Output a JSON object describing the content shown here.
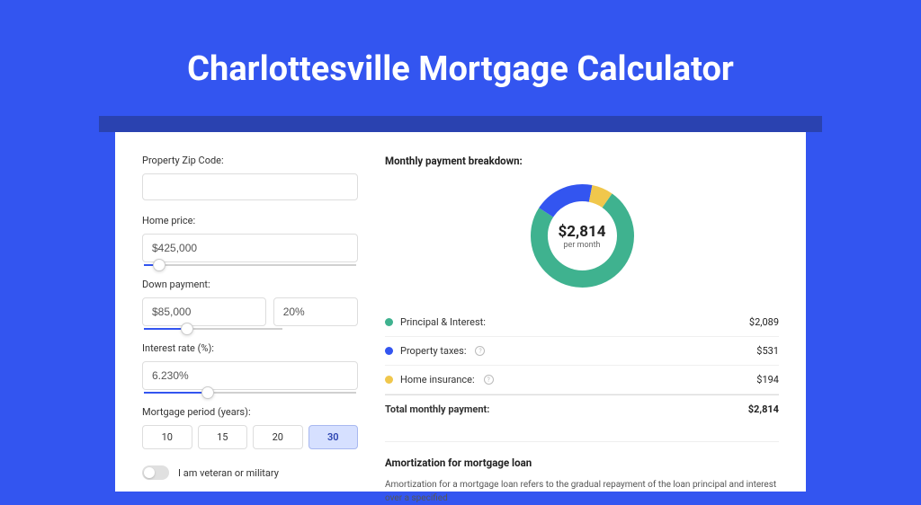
{
  "header": {
    "title": "Charlottesville Mortgage Calculator"
  },
  "form": {
    "zip_label": "Property Zip Code:",
    "zip_value": "",
    "price_label": "Home price:",
    "price_value": "$425,000",
    "price_slider_pct": 7,
    "down_label": "Down payment:",
    "down_value": "$85,000",
    "down_pct_value": "20%",
    "down_slider_pct": 20,
    "rate_label": "Interest rate (%):",
    "rate_value": "6.230%",
    "rate_slider_pct": 30,
    "period_label": "Mortgage period (years):",
    "periods": [
      "10",
      "15",
      "20",
      "30"
    ],
    "period_active": "30",
    "toggle_label": "I am veteran or military"
  },
  "breakdown": {
    "title": "Monthly payment breakdown:",
    "total_amount": "$2,814",
    "total_sub": "per month",
    "items": [
      {
        "label": "Principal & Interest:",
        "value": "$2,089",
        "color": "#3fb28f",
        "info": false
      },
      {
        "label": "Property taxes:",
        "value": "$531",
        "color": "#3355f0",
        "info": true
      },
      {
        "label": "Home insurance:",
        "value": "$194",
        "color": "#f0c74c",
        "info": true
      }
    ],
    "total_label": "Total monthly payment:",
    "total_value": "$2,814"
  },
  "amort": {
    "title": "Amortization for mortgage loan",
    "text": "Amortization for a mortgage loan refers to the gradual repayment of the loan principal and interest over a specified"
  },
  "chart_data": {
    "type": "pie",
    "title": "Monthly payment breakdown",
    "series": [
      {
        "name": "Principal & Interest",
        "value": 2089,
        "color": "#3fb28f"
      },
      {
        "name": "Property taxes",
        "value": 531,
        "color": "#3355f0"
      },
      {
        "name": "Home insurance",
        "value": 194,
        "color": "#f0c74c"
      }
    ],
    "total": 2814,
    "center_label": "$2,814 per month"
  }
}
